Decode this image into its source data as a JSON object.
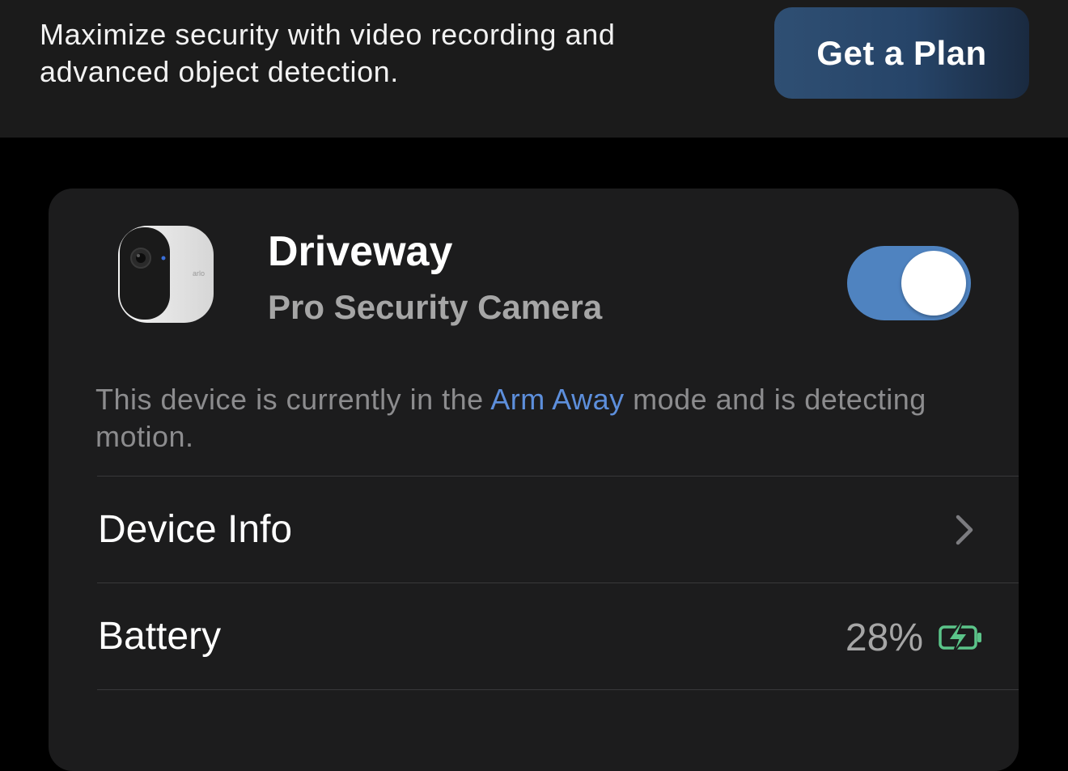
{
  "banner": {
    "message": "Maximize security with video recording and advanced object detection.",
    "plan_button_label": "Get a Plan"
  },
  "device": {
    "name": "Driveway",
    "model": "Pro Security Camera",
    "enabled": true,
    "status_prefix": "This device is currently in the ",
    "mode_link": "Arm Away",
    "status_suffix": " mode and is detecting motion."
  },
  "rows": {
    "device_info_label": "Device Info",
    "battery_label": "Battery",
    "battery_value": "28%"
  },
  "icons": {
    "camera": "security-camera-image",
    "chevron": "chevron-right-icon",
    "battery": "battery-charging-icon"
  },
  "colors": {
    "toggle_on": "#4f83c0",
    "link": "#5d8fdc",
    "battery_icon": "#5bc489"
  }
}
